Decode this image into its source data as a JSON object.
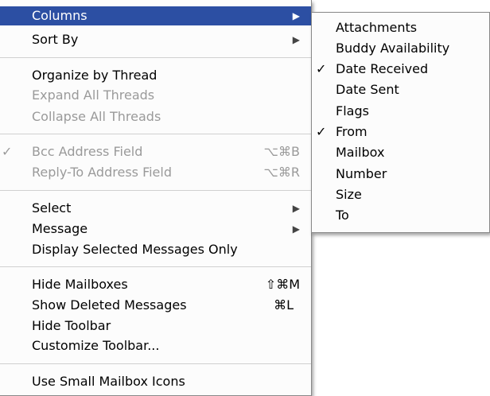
{
  "main_menu": {
    "columns": "Columns",
    "sort_by": "Sort By",
    "organize_by_thread": "Organize by Thread",
    "expand_all_threads": "Expand All Threads",
    "collapse_all_threads": "Collapse All Threads",
    "bcc_address_field": "Bcc Address Field",
    "bcc_shortcut": "⌥⌘B",
    "bcc_check": "✓",
    "reply_to_address_field": "Reply-To Address Field",
    "reply_to_shortcut": "⌥⌘R",
    "select": "Select",
    "message": "Message",
    "display_selected_messages_only": "Display Selected Messages Only",
    "hide_mailboxes": "Hide Mailboxes",
    "hide_mailboxes_shortcut": "⇧⌘M",
    "show_deleted_messages": "Show Deleted Messages",
    "show_deleted_shortcut": "⌘L",
    "hide_toolbar": "Hide Toolbar",
    "customize_toolbar": "Customize Toolbar...",
    "use_small_mailbox_icons": "Use Small Mailbox Icons",
    "submenu_arrow": "▶"
  },
  "columns_submenu": {
    "check": "✓",
    "attachments": "Attachments",
    "buddy_availability": "Buddy Availability",
    "date_received": "Date Received",
    "date_sent": "Date Sent",
    "flags": "Flags",
    "from": "From",
    "mailbox": "Mailbox",
    "number": "Number",
    "size": "Size",
    "to": "To"
  },
  "colors": {
    "highlight": "#2c4fa3",
    "disabled_text": "#9a9a9a"
  }
}
